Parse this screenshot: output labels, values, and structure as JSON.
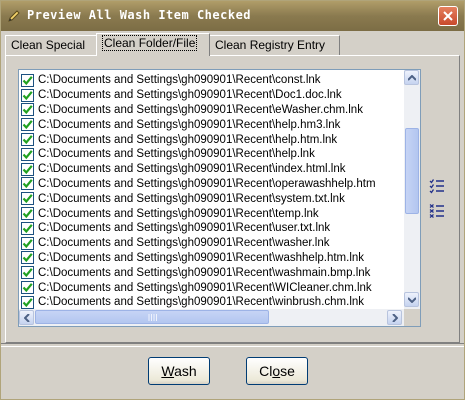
{
  "window": {
    "title": "Preview All Wash Item Checked"
  },
  "tabs": [
    {
      "label": "Clean Special",
      "active": false
    },
    {
      "label": "Clean Folder/File",
      "active": true
    },
    {
      "label": "Clean Registry Entry",
      "active": false
    }
  ],
  "list": {
    "items": [
      "C:\\Documents and Settings\\gh090901\\Recent\\const.lnk",
      "C:\\Documents and Settings\\gh090901\\Recent\\Doc1.doc.lnk",
      "C:\\Documents and Settings\\gh090901\\Recent\\eWasher.chm.lnk",
      "C:\\Documents and Settings\\gh090901\\Recent\\help.hm3.lnk",
      "C:\\Documents and Settings\\gh090901\\Recent\\help.htm.lnk",
      "C:\\Documents and Settings\\gh090901\\Recent\\help.lnk",
      "C:\\Documents and Settings\\gh090901\\Recent\\index.html.lnk",
      "C:\\Documents and Settings\\gh090901\\Recent\\operawashhelp.htm",
      "C:\\Documents and Settings\\gh090901\\Recent\\system.txt.lnk",
      "C:\\Documents and Settings\\gh090901\\Recent\\temp.lnk",
      "C:\\Documents and Settings\\gh090901\\Recent\\user.txt.lnk",
      "C:\\Documents and Settings\\gh090901\\Recent\\washer.lnk",
      "C:\\Documents and Settings\\gh090901\\Recent\\washhelp.htm.lnk",
      "C:\\Documents and Settings\\gh090901\\Recent\\washmain.bmp.lnk",
      "C:\\Documents and Settings\\gh090901\\Recent\\WICleaner.chm.lnk",
      "C:\\Documents and Settings\\gh090901\\Recent\\winbrush.chm.lnk"
    ],
    "checked": true
  },
  "side_buttons": [
    {
      "icon": "check-all-icon"
    },
    {
      "icon": "uncheck-all-icon"
    }
  ],
  "buttons": {
    "wash": {
      "prefix": "",
      "accel": "W",
      "rest": "ash"
    },
    "close": {
      "prefix": "Cl",
      "accel": "o",
      "rest": "se"
    }
  },
  "colors": {
    "title_bar": "#8a7a4f",
    "check_green": "#21a121",
    "close_red": "#c8492c"
  }
}
